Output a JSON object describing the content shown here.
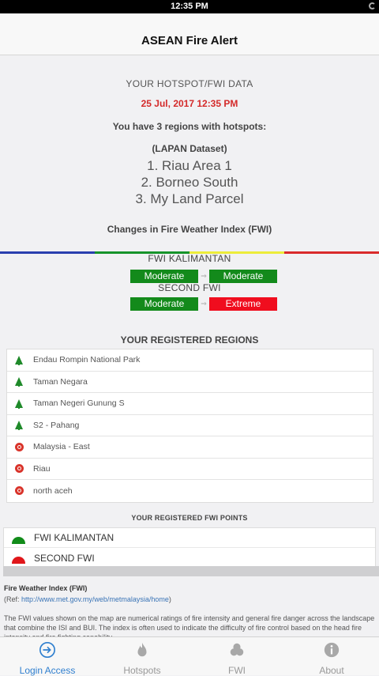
{
  "status": {
    "time": "12:35 PM"
  },
  "nav": {
    "title": "ASEAN Fire Alert"
  },
  "summary": {
    "heading": "YOUR HOTSPOT/FWI DATA",
    "datetime": "25 Jul, 2017 12:35 PM",
    "regions_count_text": "You have 3 regions with hotspots:",
    "dataset": "(LAPAN Dataset)",
    "hotspot_regions": [
      "1. Riau Area 1",
      "2. Borneo South",
      "3. My Land Parcel"
    ],
    "changes_heading": "Changes in Fire Weather Index (FWI)"
  },
  "color_strip": [
    "#2a3fae",
    "#16932a",
    "#ecec3a",
    "#d92b2b"
  ],
  "fwi_changes": [
    {
      "name": "FWI KALIMANTAN",
      "from": "Moderate",
      "to": "Moderate",
      "from_color": "#138a1b",
      "to_color": "#138a1b"
    },
    {
      "name": "SECOND FWI",
      "from": "Moderate",
      "to": "Extreme",
      "from_color": "#138a1b",
      "to_color": "#f00d1e"
    }
  ],
  "registered_regions": {
    "title": "YOUR REGISTERED REGIONS",
    "items": [
      {
        "label": "Endau Rompin National Park",
        "icon": "tree-icon"
      },
      {
        "label": "Taman Negara",
        "icon": "tree-icon"
      },
      {
        "label": "Taman Negeri Gunung S",
        "icon": "tree-icon"
      },
      {
        "label": "S2 - Pahang",
        "icon": "tree-icon"
      },
      {
        "label": "Malaysia - East",
        "icon": "fire-icon"
      },
      {
        "label": "Riau",
        "icon": "fire-icon"
      },
      {
        "label": "north aceh",
        "icon": "fire-icon"
      }
    ]
  },
  "fwi_points": {
    "title": "YOUR REGISTERED FWI POINTS",
    "items": [
      {
        "label": "FWI KALIMANTAN",
        "color": "green"
      },
      {
        "label": "SECOND FWI",
        "color": "red"
      }
    ]
  },
  "info": {
    "title": "Fire Weather Index (FWI)",
    "ref_prefix": "(Ref: ",
    "ref_link": "http://www.met.gov.my/web/metmalaysia/home",
    "ref_suffix": ")",
    "body": "The FWI values shown on the map are numerical ratings of fire intensity and general fire danger across the landscape that combine the ISI and BUI. The index is often used to indicate the difficulty of fire control based on the head fire intensity and fire fighting capability."
  },
  "tabs": [
    {
      "label": "Login Access",
      "icon": "login-icon",
      "active": true
    },
    {
      "label": "Hotspots",
      "icon": "flame-icon",
      "active": false
    },
    {
      "label": "FWI",
      "icon": "cluster-icon",
      "active": false
    },
    {
      "label": "About",
      "icon": "info-icon",
      "active": false
    }
  ]
}
